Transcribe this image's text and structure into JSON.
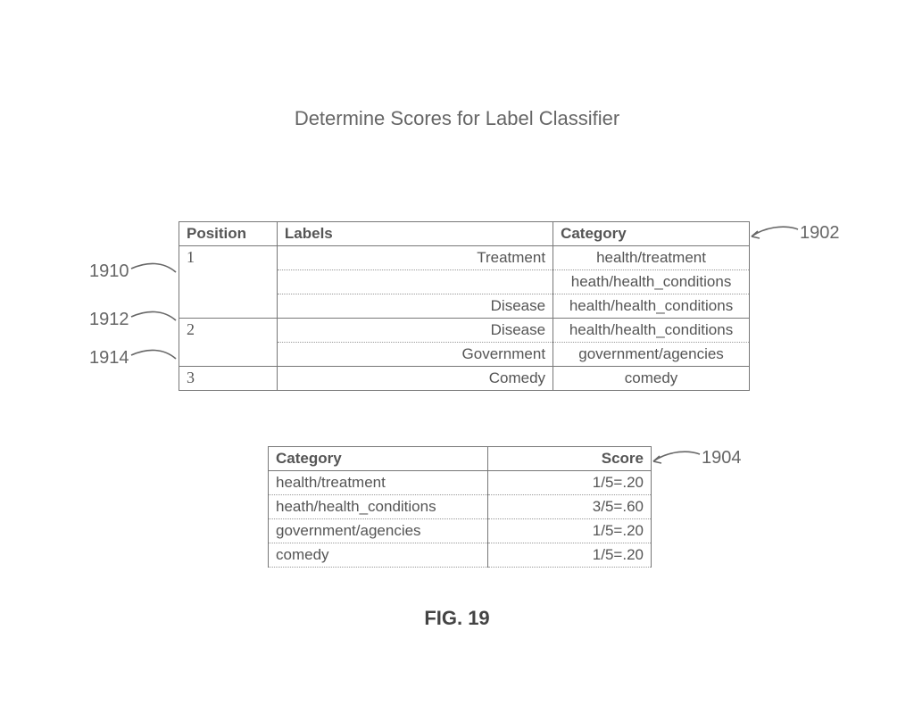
{
  "title": "Determine Scores for Label Classifier",
  "figure_label": "FIG. 19",
  "table1": {
    "headers": {
      "position": "Position",
      "labels": "Labels",
      "category": "Category"
    },
    "groups": [
      {
        "position": "1",
        "rows": [
          {
            "label": "Treatment",
            "category": "health/treatment"
          },
          {
            "label": "",
            "category": "heath/health_conditions"
          },
          {
            "label": "Disease",
            "category": "health/health_conditions"
          }
        ]
      },
      {
        "position": "2",
        "rows": [
          {
            "label": "Disease",
            "category": "health/health_conditions"
          },
          {
            "label": "Government",
            "category": "government/agencies"
          }
        ]
      },
      {
        "position": "3",
        "rows": [
          {
            "label": "Comedy",
            "category": "comedy"
          }
        ]
      }
    ]
  },
  "table2": {
    "headers": {
      "category": "Category",
      "score": "Score"
    },
    "rows": [
      {
        "category": "health/treatment",
        "score": "1/5=.20"
      },
      {
        "category": "heath/health_conditions",
        "score": "3/5=.60"
      },
      {
        "category": "government/agencies",
        "score": "1/5=.20"
      },
      {
        "category": "comedy",
        "score": "1/5=.20"
      }
    ]
  },
  "annotations": {
    "a1910": "1910",
    "a1912": "1912",
    "a1914": "1914",
    "a1902": "1902",
    "a1904": "1904"
  }
}
